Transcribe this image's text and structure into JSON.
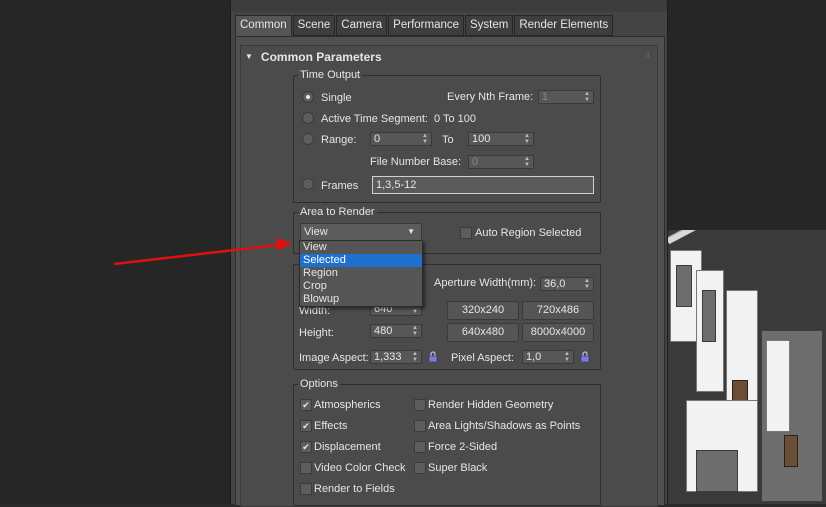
{
  "colors": {
    "accent": "#1f6fcc",
    "annotation_arrow": "#e01010",
    "panel": "#4b4b4b",
    "background": "#262626"
  },
  "tabs": [
    "Common",
    "Scene",
    "Camera",
    "Performance",
    "System",
    "Render Elements"
  ],
  "active_tab": "Common",
  "rollout": {
    "title": "Common Parameters"
  },
  "time_output": {
    "title": "Time Output",
    "single_label": "Single",
    "every_nth_label": "Every Nth Frame:",
    "every_nth_value": "1",
    "active_segment_label": "Active Time Segment:",
    "active_segment_value": "0 To 100",
    "range_label": "Range:",
    "range_from": "0",
    "to_label": "To",
    "range_to": "100",
    "file_number_base_label": "File Number Base:",
    "file_number_base_value": "0",
    "frames_label": "Frames",
    "frames_value": "1,3,5-12",
    "selected_option": "Single"
  },
  "area_to_render": {
    "title": "Area to Render",
    "current_value": "View",
    "auto_region_label": "Auto Region Selected",
    "auto_region_checked": false,
    "options": [
      "View",
      "Selected",
      "Region",
      "Crop",
      "Blowup"
    ],
    "highlighted_option": "Selected"
  },
  "output_size": {
    "aperture_label": "Aperture Width(mm):",
    "aperture_value": "36,0",
    "width_label": "Width:",
    "width_value": "640",
    "height_label": "Height:",
    "height_value": "480",
    "presets": [
      "320x240",
      "720x486",
      "640x480",
      "8000x4000"
    ],
    "image_aspect_label": "Image Aspect:",
    "image_aspect_value": "1,333",
    "pixel_aspect_label": "Pixel Aspect:",
    "pixel_aspect_value": "1,0"
  },
  "options": {
    "title": "Options",
    "items": [
      {
        "label": "Atmospherics",
        "checked": true
      },
      {
        "label": "Render Hidden Geometry",
        "checked": false
      },
      {
        "label": "Effects",
        "checked": true
      },
      {
        "label": "Area Lights/Shadows as Points",
        "checked": false
      },
      {
        "label": "Displacement",
        "checked": true
      },
      {
        "label": "Force 2-Sided",
        "checked": false
      },
      {
        "label": "Video Color Check",
        "checked": false
      },
      {
        "label": "Super Black",
        "checked": false
      },
      {
        "label": "Render to Fields",
        "checked": false
      }
    ]
  }
}
